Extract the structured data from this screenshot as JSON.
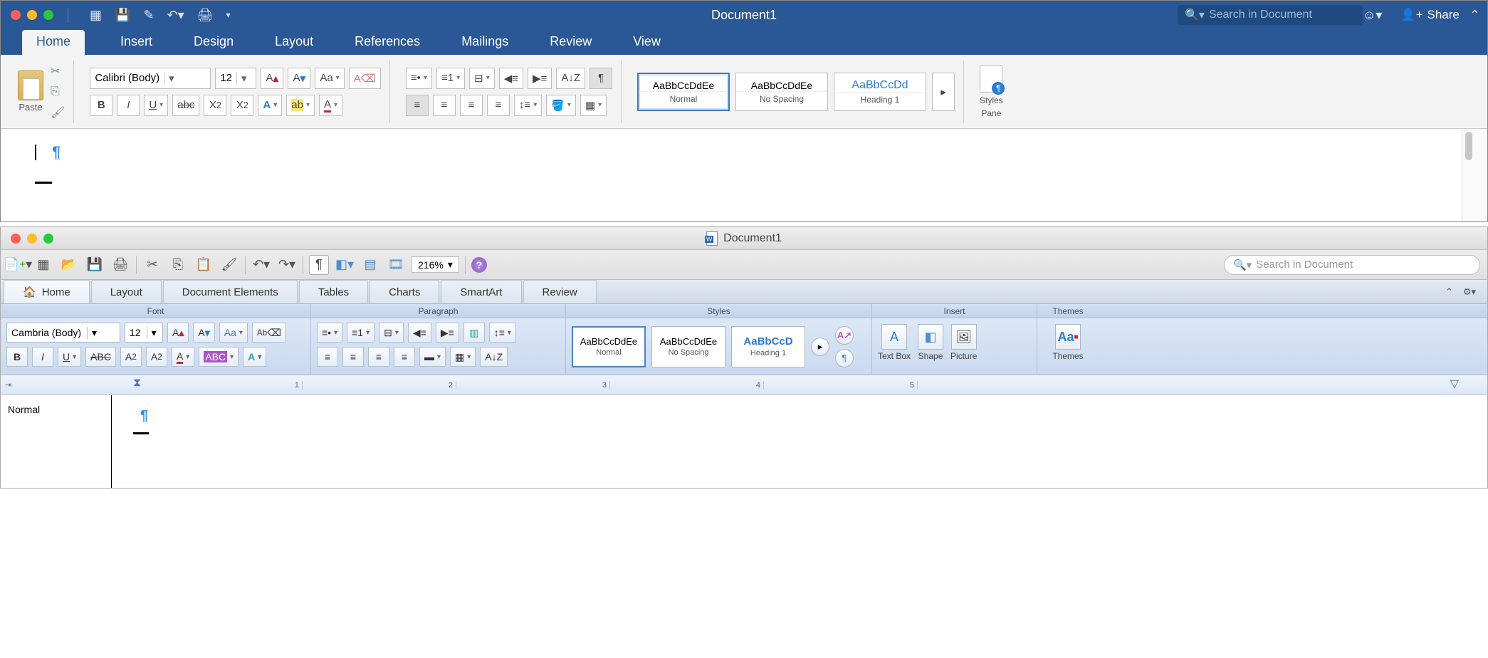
{
  "w1": {
    "title": "Document1",
    "search_placeholder": "Search in Document",
    "share": "Share",
    "tabs": [
      "Home",
      "Insert",
      "Design",
      "Layout",
      "References",
      "Mailings",
      "Review",
      "View"
    ],
    "active_tab": "Home",
    "paste": "Paste",
    "font_name": "Calibri (Body)",
    "font_size": "12",
    "styles": [
      {
        "preview": "AaBbCcDdEe",
        "name": "Normal",
        "selected": true
      },
      {
        "preview": "AaBbCcDdEe",
        "name": "No Spacing",
        "selected": false
      },
      {
        "preview": "AaBbCcDd",
        "name": "Heading 1",
        "selected": false,
        "blue": true
      }
    ],
    "styles_pane_l1": "Styles",
    "styles_pane_l2": "Pane"
  },
  "w2": {
    "title": "Document1",
    "zoom": "216%",
    "search_placeholder": "Search in Document",
    "tabs": [
      "Home",
      "Layout",
      "Document Elements",
      "Tables",
      "Charts",
      "SmartArt",
      "Review"
    ],
    "active_tab": "Home",
    "group_labels": [
      "Font",
      "Paragraph",
      "Styles",
      "Insert",
      "Themes"
    ],
    "font_name": "Cambria (Body)",
    "font_size": "12",
    "styles": [
      {
        "preview": "AaBbCcDdEe",
        "name": "Normal",
        "selected": true
      },
      {
        "preview": "AaBbCcDdEe",
        "name": "No Spacing",
        "selected": false
      },
      {
        "preview": "AaBbCcD",
        "name": "Heading 1",
        "selected": false,
        "blue": true
      }
    ],
    "insert": [
      "Text Box",
      "Shape",
      "Picture"
    ],
    "themes": "Themes",
    "ruler": [
      "1",
      "2",
      "3",
      "4",
      "5"
    ],
    "style_panel": "Normal"
  }
}
